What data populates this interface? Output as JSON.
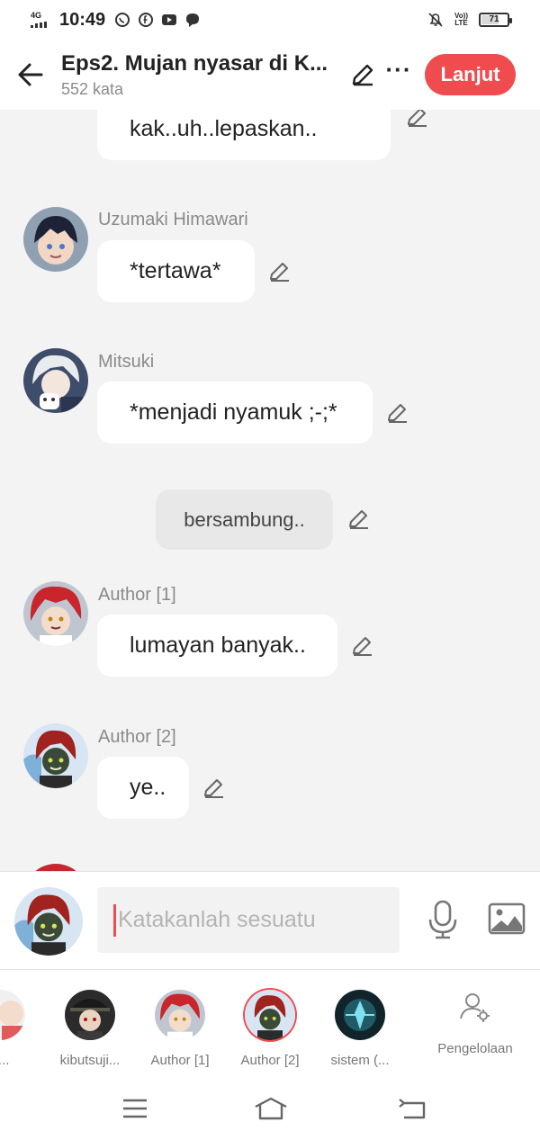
{
  "status_bar": {
    "network": "4G",
    "time": "10:49",
    "volte_top": "Vo))",
    "volte_bottom": "LTE",
    "battery": "71",
    "battery_level": 0.71
  },
  "header": {
    "title": "Eps2. Mujan nyasar di K...",
    "word_count": "552 kata",
    "continue_label": "Lanjut"
  },
  "chat": {
    "partial_bubble_text": "kak..uh..lepaskan..",
    "messages": [
      {
        "sender": "Uzumaki Himawari",
        "text": "*tertawa*"
      },
      {
        "sender": "Mitsuki",
        "text": "*menjadi nyamuk ;-;*"
      },
      {
        "sender": "",
        "text": "bersambung..",
        "narration": true
      },
      {
        "sender": "Author [1]",
        "text": "lumayan banyak.."
      },
      {
        "sender": "Author [2]",
        "text": "ye.."
      }
    ]
  },
  "input": {
    "placeholder": "Katakanlah sesuatu"
  },
  "characters": [
    {
      "label": "p..."
    },
    {
      "label": "kibutsuji..."
    },
    {
      "label": "Author [1]"
    },
    {
      "label": "Author [2]",
      "selected": true
    },
    {
      "label": "sistem (..."
    }
  ],
  "management_label": "Pengelolaan",
  "colors": {
    "accent": "#f04b4f",
    "background": "#f3f3f3",
    "bubble": "#ffffff",
    "muted_text": "#8a8a8a"
  }
}
